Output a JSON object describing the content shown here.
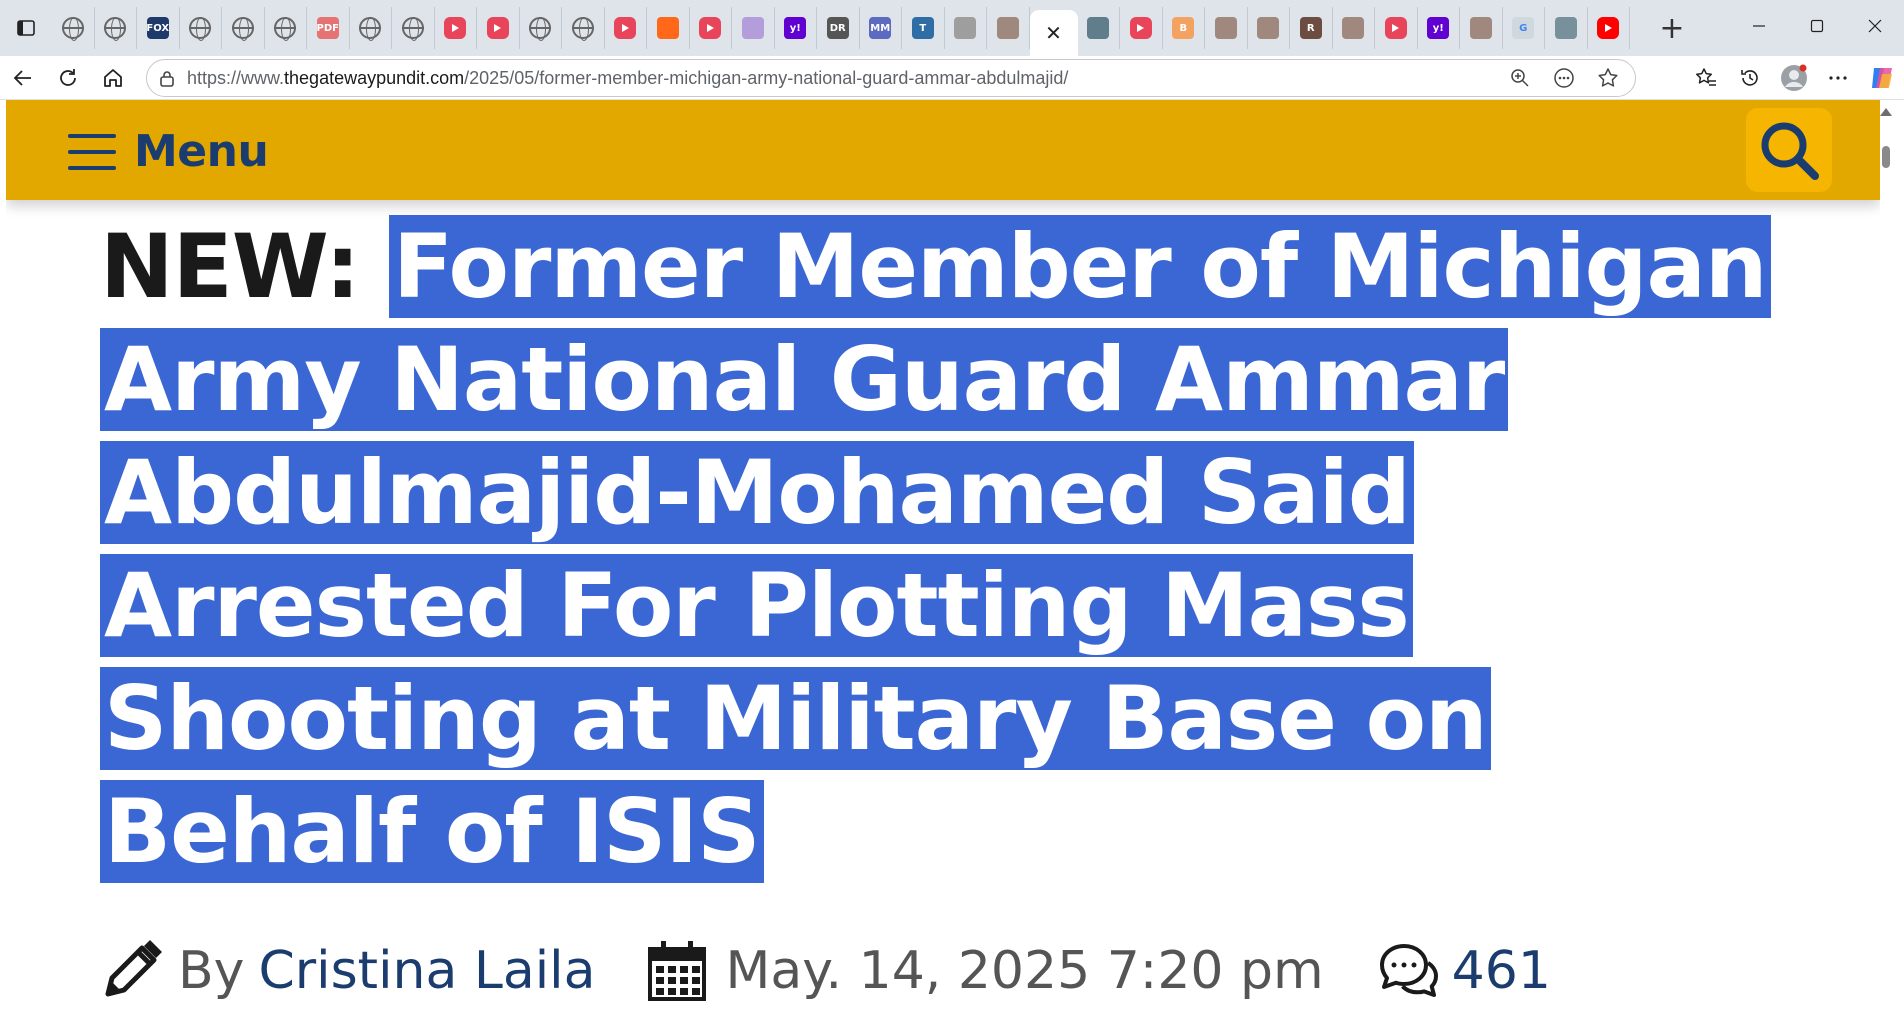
{
  "browser": {
    "tabs": [
      {
        "icon": "globe-icon"
      },
      {
        "icon": "globe-icon"
      },
      {
        "icon": "fox-news-icon",
        "badge": "FOX"
      },
      {
        "icon": "globe-icon"
      },
      {
        "icon": "globe-icon"
      },
      {
        "icon": "globe-icon"
      },
      {
        "icon": "pdf-icon",
        "badge": "PDF"
      },
      {
        "icon": "globe-icon"
      },
      {
        "icon": "globe-icon"
      },
      {
        "icon": "youtube-icon"
      },
      {
        "icon": "youtube-icon"
      },
      {
        "icon": "globe-icon"
      },
      {
        "icon": "globe-icon"
      },
      {
        "icon": "youtube-icon"
      },
      {
        "icon": "substack-icon"
      },
      {
        "icon": "youtube-icon"
      },
      {
        "icon": "feather-icon"
      },
      {
        "icon": "yahoo-icon",
        "badge": "y!"
      },
      {
        "icon": "dr-icon",
        "badge": "DR"
      },
      {
        "icon": "mm-icon",
        "badge": "MM"
      },
      {
        "icon": "letter-t-icon",
        "badge": "T"
      },
      {
        "icon": "seal-icon"
      },
      {
        "icon": "photo-icon"
      },
      {
        "icon": "close-icon",
        "active": true
      },
      {
        "icon": "diamond-icon"
      },
      {
        "icon": "youtube-icon"
      },
      {
        "icon": "blogger-icon",
        "badge": "B"
      },
      {
        "icon": "photo-icon"
      },
      {
        "icon": "photo-icon"
      },
      {
        "icon": "letter-r-icon",
        "badge": "R"
      },
      {
        "icon": "photo-icon"
      },
      {
        "icon": "youtube-icon"
      },
      {
        "icon": "yahoo-icon",
        "badge": "y!"
      },
      {
        "icon": "photo-icon"
      },
      {
        "icon": "google-icon",
        "badge": "G"
      },
      {
        "icon": "info-icon"
      },
      {
        "icon": "youtube-red-icon"
      }
    ],
    "url_prefix": "https://www.",
    "url_domain": "thegatewaypundit.com",
    "url_path": "/2025/05/former-member-michigan-army-national-guard-ammar-abdulmajid/"
  },
  "site": {
    "menu_label": "Menu"
  },
  "article": {
    "prefix": "NEW: ",
    "title": "Former Member of Michigan Army National Guard Ammar Abdulmajid-Mohamed Said Arrested For Plotting Mass Shooting at Military Base on Behalf of ISIS",
    "by_label": "By",
    "author": "Cristina Laila",
    "date": "May. 14, 2025 7:20 pm",
    "comments_count": "461"
  },
  "colors": {
    "header_bg": "#e3a800",
    "brand_blue": "#1b3c6e",
    "selection": "#3a67d3"
  }
}
